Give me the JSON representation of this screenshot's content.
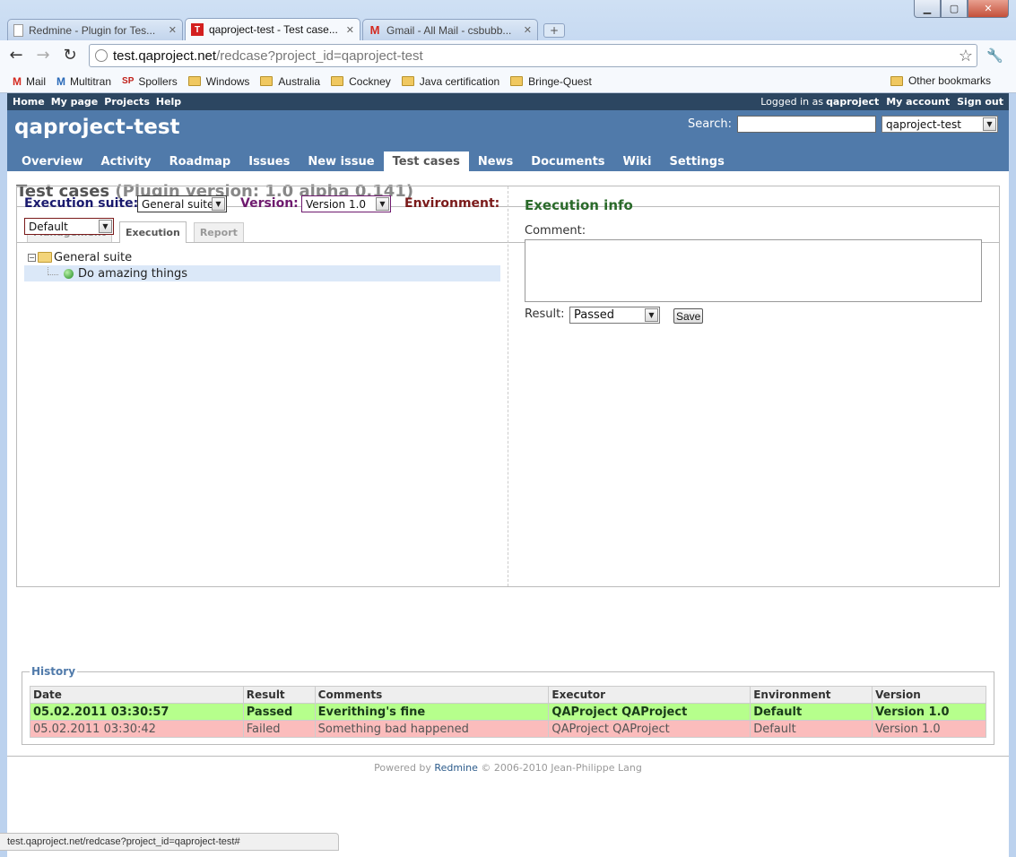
{
  "browser": {
    "tabs": [
      {
        "title": "Redmine - Plugin for Tes...",
        "favicon": "doc"
      },
      {
        "title": "qaproject-test - Test case...",
        "favicon": "T"
      },
      {
        "title": "Gmail - All Mail - csbubb...",
        "favicon": "M"
      }
    ],
    "url_host": "test.qaproject.net",
    "url_path": "/redcase?project_id=qaproject-test",
    "bookmarks": [
      "Mail",
      "Multitran",
      "Spollers",
      "Windows",
      "Australia",
      "Cockney",
      "Java certification",
      "Bringe-Quest"
    ],
    "other_bookmarks": "Other bookmarks",
    "status_url": "test.qaproject.net/redcase?project_id=qaproject-test#"
  },
  "topmenu": {
    "home": "Home",
    "mypage": "My page",
    "projects": "Projects",
    "help": "Help",
    "logged_in_as": "Logged in as",
    "user": "qaproject",
    "my_account": "My account",
    "sign_out": "Sign out"
  },
  "header": {
    "project_title": "qaproject-test",
    "search_label": "Search:",
    "project_jump": "qaproject-test"
  },
  "mainmenu": [
    "Overview",
    "Activity",
    "Roadmap",
    "Issues",
    "New issue",
    "Test cases",
    "News",
    "Documents",
    "Wiki",
    "Settings"
  ],
  "page": {
    "title": "Test cases",
    "plugin_version": "(Plugin version: 1.0 alpha 0.141)"
  },
  "subtabs": [
    "Management",
    "Execution",
    "Report"
  ],
  "execution": {
    "suite_label": "Execution suite:",
    "suite_value": "General suite",
    "version_label": "Version:",
    "version_value": "Version 1.0",
    "environment_label": "Environment:",
    "environment_value": "Default",
    "tree": {
      "root": "General suite",
      "child": "Do amazing things"
    }
  },
  "exec_info": {
    "title": "Execution info",
    "comment_label": "Comment:",
    "result_label": "Result:",
    "result_value": "Passed",
    "save_label": "Save"
  },
  "history": {
    "legend": "History",
    "columns": [
      "Date",
      "Result",
      "Comments",
      "Executor",
      "Environment",
      "Version"
    ],
    "rows": [
      {
        "date": "05.02.2011 03:30:57",
        "result": "Passed",
        "comments": "Everithing's fine",
        "executor": "QAProject QAProject",
        "environment": "Default",
        "version": "Version 1.0"
      },
      {
        "date": "05.02.2011 03:30:42",
        "result": "Failed",
        "comments": "Something bad happened",
        "executor": "QAProject QAProject",
        "environment": "Default",
        "version": "Version 1.0"
      }
    ]
  },
  "footer": {
    "powered_by": "Powered by",
    "redmine": "Redmine",
    "copyright": "© 2006-2010 Jean-Philippe Lang"
  }
}
